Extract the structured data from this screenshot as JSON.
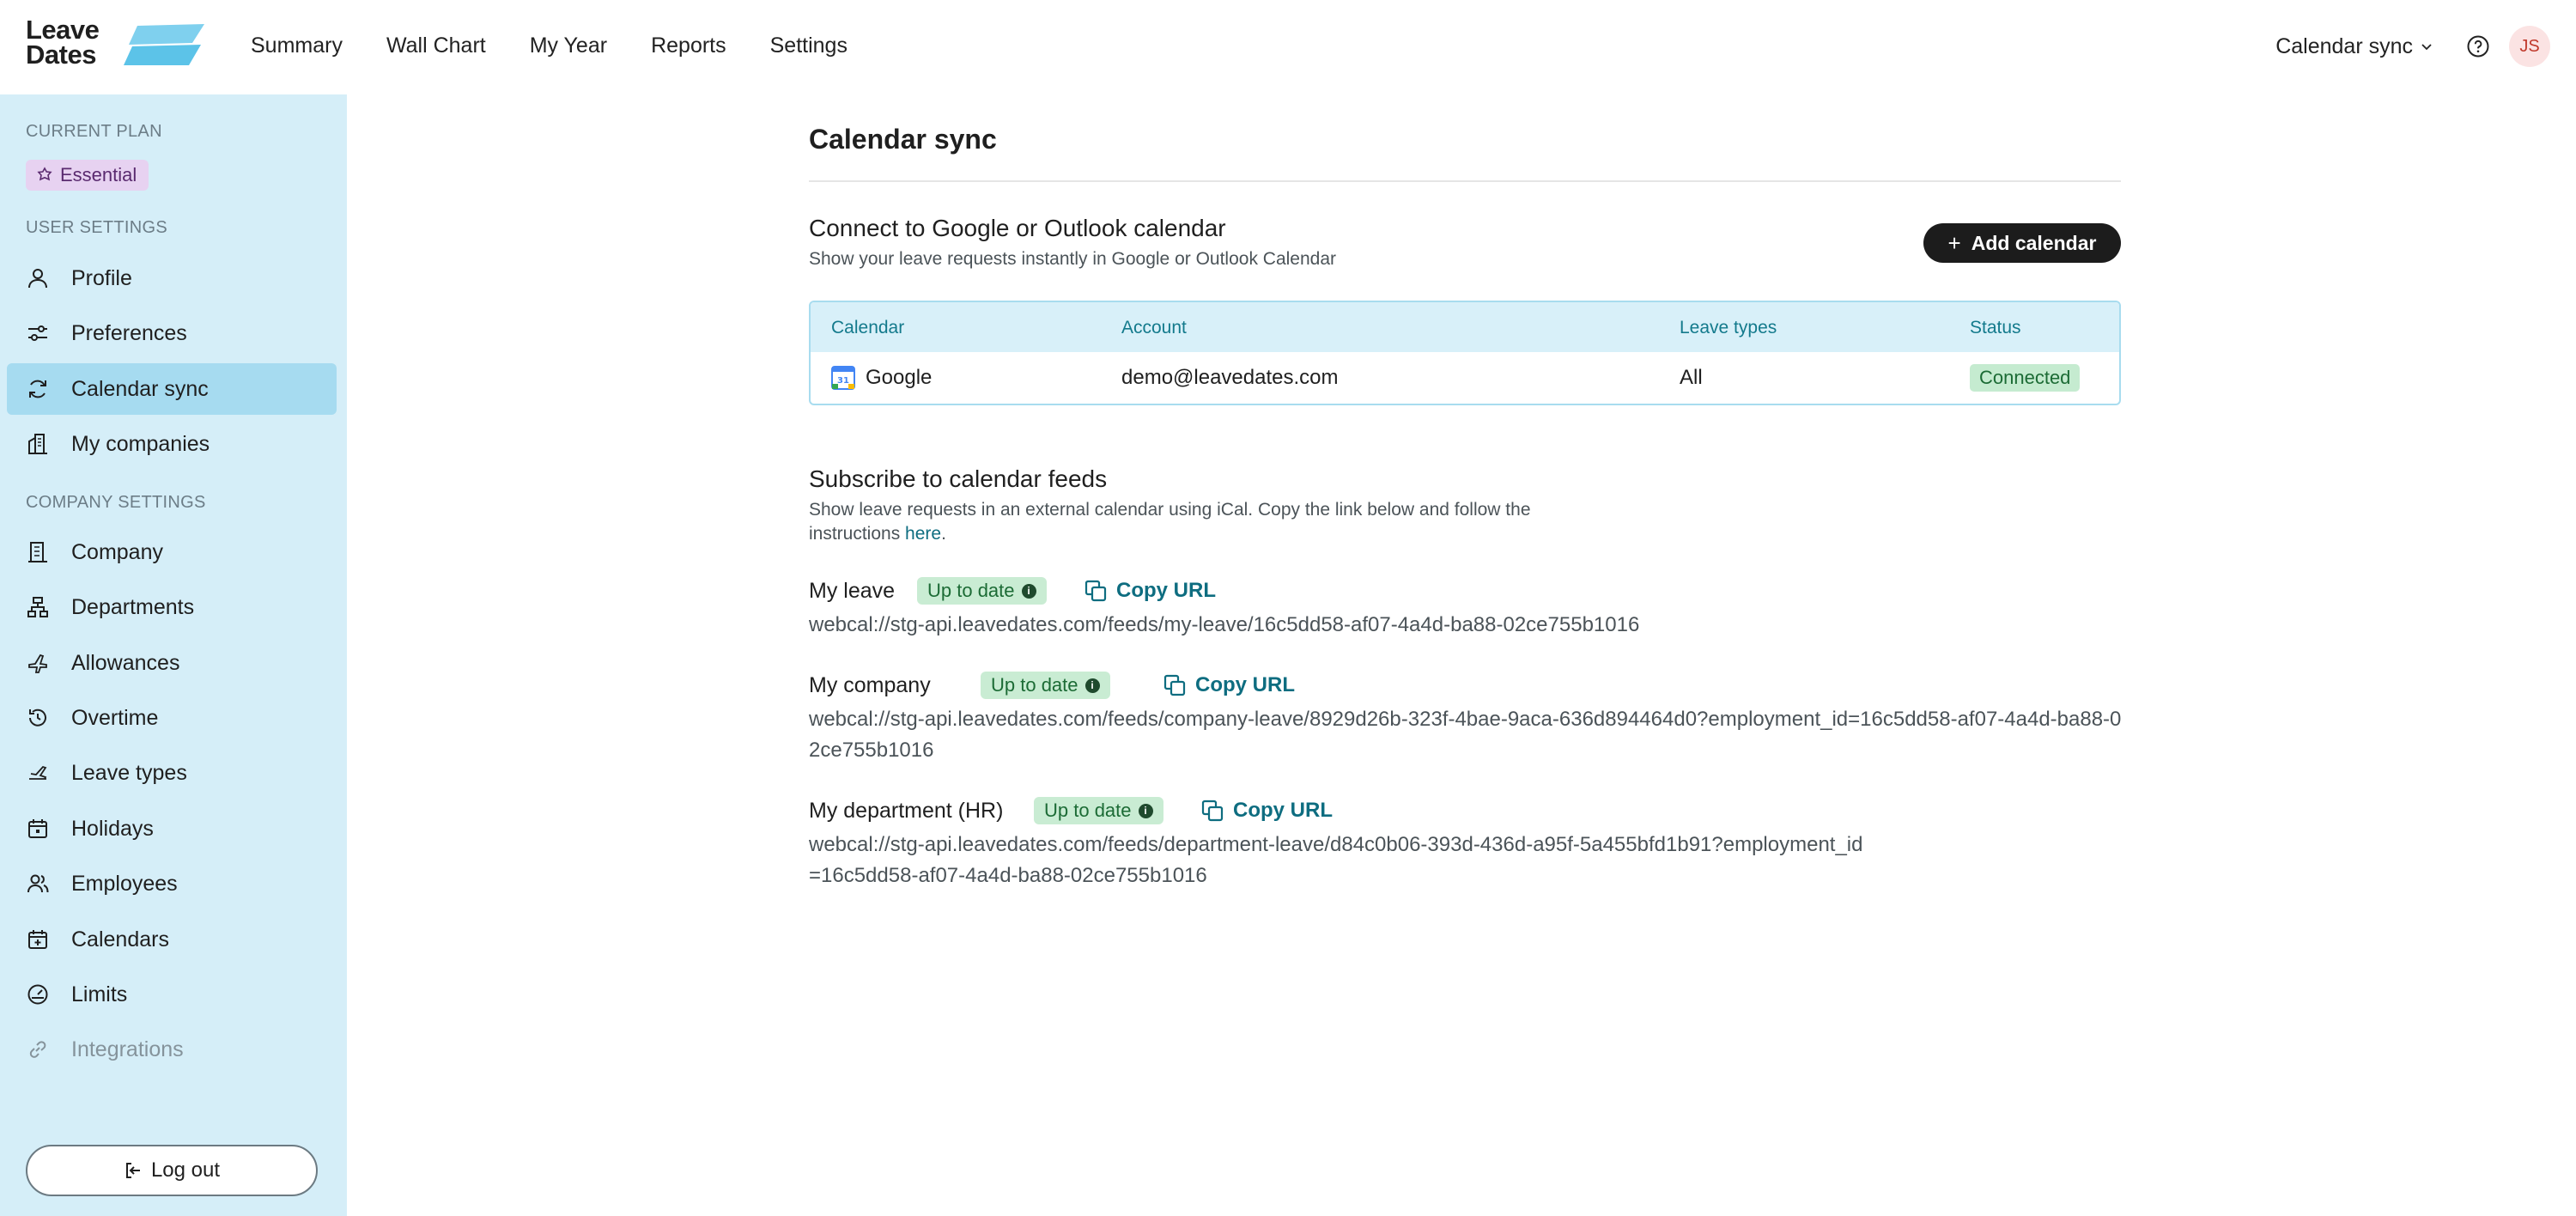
{
  "logo": {
    "line1": "Leave",
    "line2": "Dates"
  },
  "topnav": {
    "items": [
      "Summary",
      "Wall Chart",
      "My Year",
      "Reports",
      "Settings"
    ],
    "calendar_sync_menu": "Calendar sync",
    "avatar_initials": "JS"
  },
  "sidebar": {
    "current_plan_label": "CURRENT PLAN",
    "plan_name": "Essential",
    "user_settings_label": "USER SETTINGS",
    "user_items": [
      "Profile",
      "Preferences",
      "Calendar sync",
      "My companies"
    ],
    "company_settings_label": "COMPANY SETTINGS",
    "company_items": [
      "Company",
      "Departments",
      "Allowances",
      "Overtime",
      "Leave types",
      "Holidays",
      "Employees",
      "Calendars",
      "Limits",
      "Integrations"
    ],
    "logout_label": "Log out"
  },
  "main": {
    "title": "Calendar sync",
    "connect": {
      "title": "Connect to Google or Outlook calendar",
      "subtitle": "Show your leave requests instantly in Google or Outlook Calendar",
      "add_button": "Add calendar",
      "table": {
        "headers": [
          "Calendar",
          "Account",
          "Leave types",
          "Status"
        ],
        "rows": [
          {
            "calendar": "Google",
            "account": "demo@leavedates.com",
            "leave_types": "All",
            "status": "Connected"
          }
        ]
      }
    },
    "subscribe": {
      "title": "Subscribe to calendar feeds",
      "subtitle_line1": "Show leave requests in an external calendar using iCal. Copy the link below and follow the",
      "subtitle_line2_prefix": "instructions ",
      "here_link": "here",
      "subtitle_line2_suffix": ".",
      "status_label": "Up to date",
      "copy_label": "Copy URL",
      "feeds": [
        {
          "title": "My leave",
          "url": "webcal://stg-api.leavedates.com/feeds/my-leave/16c5dd58-af07-4a4d-ba88-02ce755b1016"
        },
        {
          "title": "My company",
          "url": "webcal://stg-api.leavedates.com/feeds/company-leave/8929d26b-323f-4bae-9aca-636d894464d0?employment_id=16c5dd58-af07-4a4d-ba88-02ce755b1016"
        },
        {
          "title": "My department (HR)",
          "url": "webcal://stg-api.leavedates.com/feeds/department-leave/d84c0b06-393d-436d-a95f-5a455bfd1b91?employment_id=16c5dd58-af07-4a4d-ba88-02ce755b1016"
        }
      ]
    }
  }
}
